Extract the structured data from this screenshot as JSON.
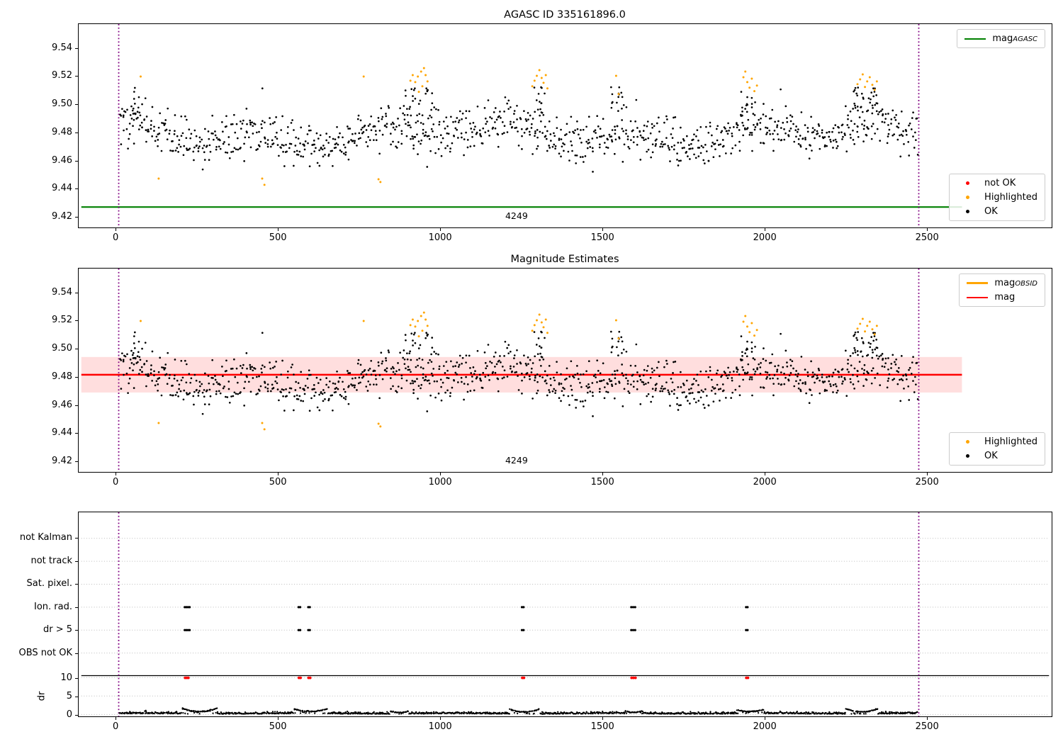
{
  "colors": {
    "green": "#008000",
    "red": "#ff0000",
    "orange": "#ffa500",
    "black": "#000000",
    "purple": "#800080",
    "band": "rgba(255,0,0,0.13)",
    "grid": "#bbbbbb"
  },
  "plots": {
    "top": {
      "title": "AGASC ID 335161896.0",
      "annotation": "4249",
      "legend_line": {
        "main": "mag",
        "sub": "AGASC"
      },
      "legend_points": [
        "not OK",
        "Highlighted",
        "OK"
      ],
      "yticks": [
        "9.42",
        "9.44",
        "9.46",
        "9.48",
        "9.50",
        "9.52",
        "9.54"
      ],
      "xticks": [
        "0",
        "500",
        "1000",
        "1500",
        "2000",
        "2500"
      ]
    },
    "middle": {
      "title": "Magnitude Estimates",
      "annotation": "4249",
      "legend_lines": [
        {
          "main": "mag",
          "sub": "OBSID"
        },
        {
          "main": "mag",
          "sub": ""
        }
      ],
      "legend_points": [
        "Highlighted",
        "OK"
      ],
      "yticks": [
        "9.42",
        "9.44",
        "9.46",
        "9.48",
        "9.50",
        "9.52",
        "9.54"
      ],
      "xticks": [
        "0",
        "500",
        "1000",
        "1500",
        "2000",
        "2500"
      ]
    },
    "bottom": {
      "categories": [
        "not Kalman",
        "not track",
        "Sat. pixel.",
        "Ion. rad.",
        "dr > 5",
        "OBS not OK"
      ],
      "dr_ticks": [
        "0",
        "5",
        "10"
      ],
      "ylabel": "dr",
      "xticks": [
        "0",
        "500",
        "1000",
        "1500",
        "2000",
        "2500"
      ]
    }
  },
  "chart_data": [
    {
      "id": "top",
      "type": "scatter",
      "title": "AGASC ID 335161896.0",
      "xlim": [
        -116,
        2886
      ],
      "ylim": [
        9.412,
        9.5575
      ],
      "xticks": [
        0,
        500,
        1000,
        1500,
        2000,
        2500
      ],
      "yticks": [
        9.42,
        9.44,
        9.46,
        9.48,
        9.5,
        9.52,
        9.54
      ],
      "mag_agasc_line": {
        "value": 9.4266,
        "color": "#008000",
        "x_start_edge": true,
        "x_end": 2616
      },
      "vlines": {
        "x": [
          0,
          2482
        ],
        "color": "#800080"
      },
      "annotation": {
        "text": "4249",
        "x": 1233
      },
      "legend1": [
        {
          "label": "mag_AGASC",
          "color": "#008000",
          "type": "line"
        }
      ],
      "legend2": [
        {
          "label": "not OK",
          "color": "#ff0000"
        },
        {
          "label": "Highlighted",
          "color": "#ffa500"
        },
        {
          "label": "OK",
          "color": "#000000"
        }
      ],
      "series": {
        "ok": {
          "color": "#000000",
          "gen": {
            "seed": 42,
            "n": 1080,
            "x_range": [
              4,
              2478
            ],
            "base": 9.4787,
            "wave1": {
              "amp": 0.0052,
              "freq": 0.0162,
              "phase": 0.8
            },
            "wave2": {
              "amp": 0.0045,
              "freq": 0.0053,
              "phase": 2.1
            },
            "noise": 0.0082,
            "clip": [
              9.4425,
              9.5145
            ]
          },
          "peaks": {
            "seed": 7,
            "centers": [
              60,
              910,
              950,
              1300,
              1545,
              1950,
              2290,
              2330
            ],
            "extra_per": 13,
            "spread": 24,
            "y_range": [
              9.492,
              9.5125
            ]
          }
        },
        "highlighted": {
          "color": "#ffa500",
          "points": [
            [
              68,
              9.52
            ],
            [
              124,
              9.447
            ],
            [
              445,
              9.447
            ],
            [
              452,
              9.4425
            ],
            [
              760,
              9.52
            ],
            [
              806,
              9.4465
            ],
            [
              812,
              9.4445
            ],
            [
              905,
              9.517
            ],
            [
              912,
              9.521
            ],
            [
              920,
              9.516
            ],
            [
              928,
              9.52
            ],
            [
              931,
              9.509
            ],
            [
              938,
              9.5235
            ],
            [
              942,
              9.513
            ],
            [
              947,
              9.526
            ],
            [
              952,
              9.521
            ],
            [
              958,
              9.5165
            ],
            [
              1283,
              9.513
            ],
            [
              1290,
              9.517
            ],
            [
              1297,
              9.5205
            ],
            [
              1305,
              9.5245
            ],
            [
              1312,
              9.519
            ],
            [
              1318,
              9.5155
            ],
            [
              1325,
              9.521
            ],
            [
              1330,
              9.5115
            ],
            [
              1543,
              9.5205
            ],
            [
              1551,
              9.5075
            ],
            [
              1938,
              9.5195
            ],
            [
              1944,
              9.5235
            ],
            [
              1950,
              9.516
            ],
            [
              1957,
              9.512
            ],
            [
              1964,
              9.5185
            ],
            [
              1972,
              9.5095
            ],
            [
              1980,
              9.5135
            ],
            [
              2292,
              9.5145
            ],
            [
              2300,
              9.518
            ],
            [
              2308,
              9.5215
            ],
            [
              2315,
              9.5125
            ],
            [
              2322,
              9.5165
            ],
            [
              2330,
              9.5195
            ],
            [
              2338,
              9.514
            ],
            [
              2345,
              9.5105
            ],
            [
              2352,
              9.5165
            ]
          ]
        }
      }
    },
    {
      "id": "middle",
      "type": "scatter",
      "title": "Magnitude Estimates",
      "xlim": [
        -116,
        2886
      ],
      "ylim": [
        9.412,
        9.5575
      ],
      "xticks": [
        0,
        500,
        1000,
        1500,
        2000,
        2500
      ],
      "yticks": [
        9.42,
        9.44,
        9.46,
        9.48,
        9.5,
        9.52,
        9.54
      ],
      "mag_line": {
        "value": 9.4815,
        "color": "#ff0000",
        "x_end": 2616
      },
      "mag_band": {
        "lo": 9.4688,
        "hi": 9.4942,
        "color": "rgba(255,0,0,0.13)",
        "x_end": 2616
      },
      "vlines": {
        "x": [
          0,
          2482
        ],
        "color": "#800080"
      },
      "annotation": {
        "text": "4249",
        "x": 1233
      },
      "legend1": [
        {
          "label": "mag_OBSID",
          "color": "#ffa500",
          "type": "line"
        },
        {
          "label": "mag",
          "color": "#ff0000",
          "type": "line"
        }
      ],
      "legend2": [
        {
          "label": "Highlighted",
          "color": "#ffa500"
        },
        {
          "label": "OK",
          "color": "#000000"
        }
      ],
      "series_ref": "top"
    },
    {
      "id": "bottom",
      "type": "flags_dr",
      "xlim": [
        -116,
        2886
      ],
      "xticks": [
        0,
        500,
        1000,
        1500,
        2000,
        2500
      ],
      "categories": [
        "not Kalman",
        "not track",
        "Sat. pixel.",
        "Ion. rad.",
        "dr > 5",
        "OBS not OK"
      ],
      "dr_ticks": [
        0,
        5,
        10
      ],
      "separator_dr": 10.5,
      "vlines": {
        "x": [
          0,
          2482
        ],
        "color": "#800080"
      },
      "flag_rows": {
        "Ion. rad.": 3,
        "dr > 5": 4
      },
      "flags_x": [
        205,
        210,
        215,
        220,
        558,
        563,
        588,
        593,
        1251,
        1256,
        1590,
        1596,
        1602,
        1946,
        1951
      ],
      "dr_capped": {
        "value": 9.9,
        "color": "#ff0000",
        "x": [
          206,
          211,
          216,
          559,
          564,
          589,
          594,
          1252,
          1257,
          1591,
          1597,
          1603,
          1947,
          1952
        ]
      },
      "dr_series": {
        "color": "#000000",
        "gen": {
          "seed": 11,
          "n": 1400,
          "x_range": [
            2,
            2478
          ],
          "base": 0.18,
          "fold": 0.22,
          "wave": {
            "amp": 0.06,
            "freq": 0.013,
            "phase": 0.5
          },
          "clip": [
            0.03,
            2.0
          ]
        },
        "arcs": [
          {
            "c": 250,
            "w": 55,
            "edge": 1.7,
            "mid": 0.75
          },
          {
            "c": 595,
            "w": 52,
            "edge": 1.5,
            "mid": 0.8
          },
          {
            "c": 870,
            "w": 30,
            "edge": 0.95,
            "mid": 0.5
          },
          {
            "c": 1258,
            "w": 46,
            "edge": 1.45,
            "mid": 0.7
          },
          {
            "c": 1597,
            "w": 26,
            "edge": 0.95,
            "mid": 0.55
          },
          {
            "c": 1958,
            "w": 42,
            "edge": 1.25,
            "mid": 0.8
          },
          {
            "c": 2305,
            "w": 50,
            "edge": 1.55,
            "mid": 0.7
          }
        ]
      }
    }
  ]
}
